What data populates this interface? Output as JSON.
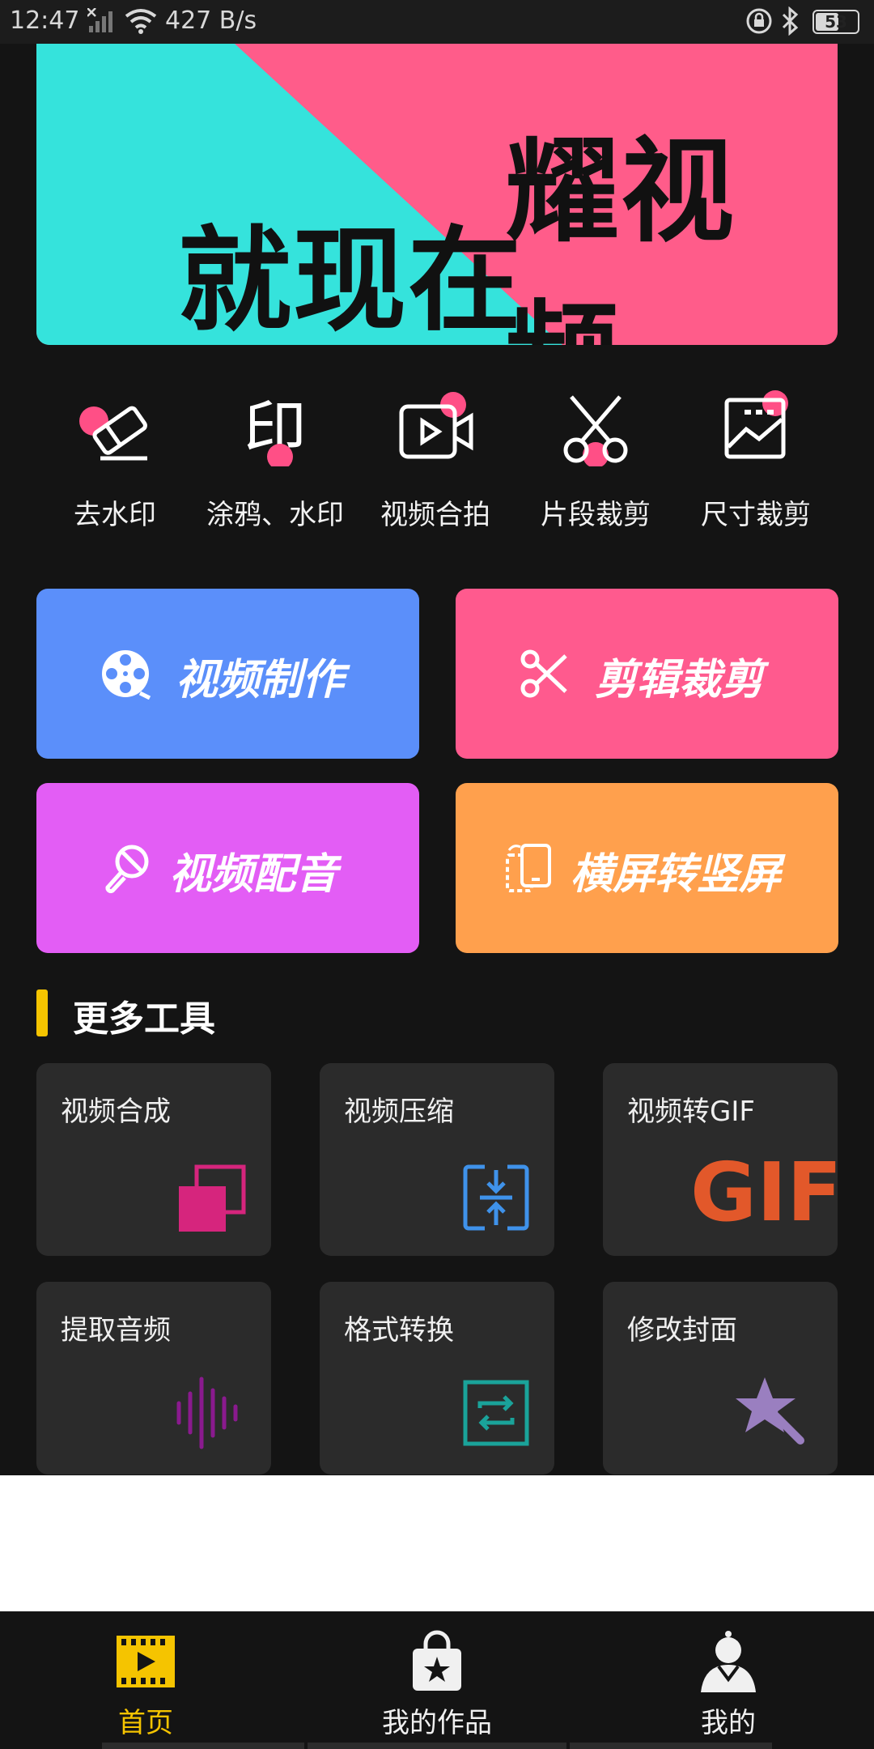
{
  "status_bar": {
    "time": "12:47",
    "network_speed": "427 B/s",
    "battery": "53"
  },
  "banner": {
    "line1": "耀视频",
    "line2": "就现在",
    "colors": {
      "left": "#35e3dc",
      "right": "#ff5c8a"
    }
  },
  "quick_tools": [
    {
      "label": "去水印",
      "icon": "eraser-icon"
    },
    {
      "label": "涂鸦、水印",
      "icon": "stamp-icon"
    },
    {
      "label": "视频合拍",
      "icon": "video-camera-icon"
    },
    {
      "label": "片段裁剪",
      "icon": "scissors-icon"
    },
    {
      "label": "尺寸裁剪",
      "icon": "image-crop-icon"
    }
  ],
  "feature_buttons": [
    {
      "label": "视频制作",
      "icon": "film-reel-icon",
      "color": "#5b8ffa"
    },
    {
      "label": "剪辑裁剪",
      "icon": "scissors-icon",
      "color": "#ff5a8e"
    },
    {
      "label": "视频配音",
      "icon": "microphone-icon",
      "color": "#e35df5"
    },
    {
      "label": "横屏转竖屏",
      "icon": "rotate-screen-icon",
      "color": "#ffa04d"
    }
  ],
  "more_tools": {
    "title": "更多工具",
    "items": [
      {
        "label": "视频合成",
        "icon": "merge-icon"
      },
      {
        "label": "视频压缩",
        "icon": "compress-icon"
      },
      {
        "label": "视频转GIF",
        "icon": "gif-icon",
        "icon_text": "GIF"
      },
      {
        "label": "提取音频",
        "icon": "audio-wave-icon"
      },
      {
        "label": "格式转换",
        "icon": "convert-icon"
      },
      {
        "label": "修改封面",
        "icon": "star-wand-icon"
      }
    ]
  },
  "bottom_nav": [
    {
      "label": "首页",
      "icon": "film-icon",
      "active": true,
      "color": "#f5c400"
    },
    {
      "label": "我的作品",
      "icon": "bag-star-icon",
      "active": false,
      "color": "#f0f0f0"
    },
    {
      "label": "我的",
      "icon": "user-icon",
      "active": false,
      "color": "#f0f0f0"
    }
  ]
}
